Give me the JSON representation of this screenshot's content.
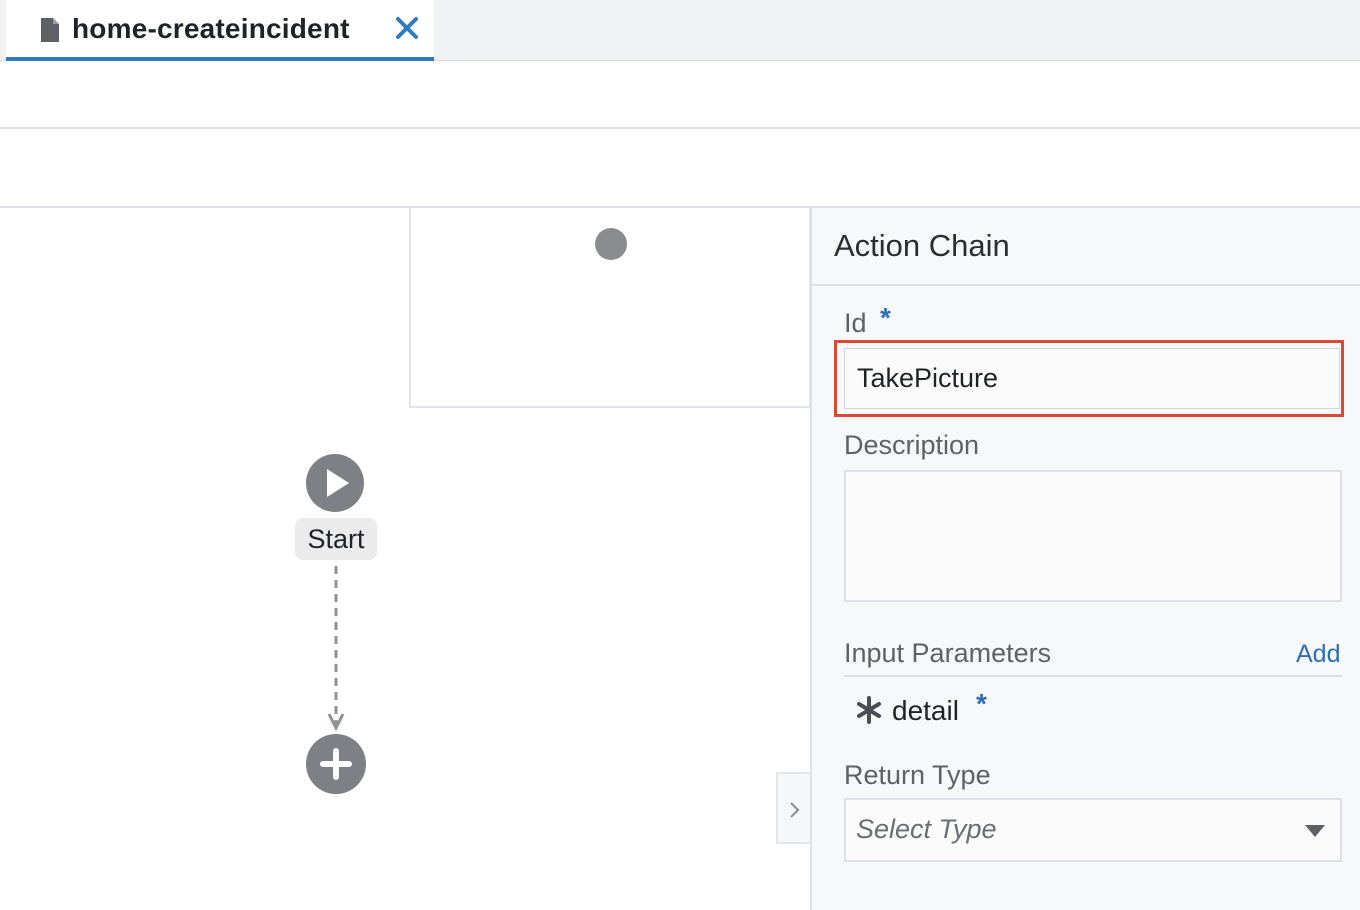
{
  "tab": {
    "title": "home-createincident",
    "icon": "file-icon",
    "close_icon": "close-icon"
  },
  "canvas": {
    "start_label": "Start",
    "start_icon": "play-icon",
    "add_icon": "plus-icon",
    "collapse_icon": "chevron-right-icon"
  },
  "panel": {
    "title": "Action Chain",
    "id_label": "Id",
    "required_mark": "*",
    "id_value": "TakePicture",
    "description_label": "Description",
    "description_value": "",
    "input_parameters_label": "Input Parameters",
    "add_label": "Add",
    "parameters": [
      {
        "name": "detail",
        "required": "*",
        "icon": "asterisk-icon"
      }
    ],
    "return_type_label": "Return Type",
    "return_type_placeholder": "Select Type"
  },
  "colors": {
    "accent": "#2e7bc4",
    "link": "#2d6eb8",
    "highlight": "#d94a35",
    "node": "#7d8085"
  }
}
